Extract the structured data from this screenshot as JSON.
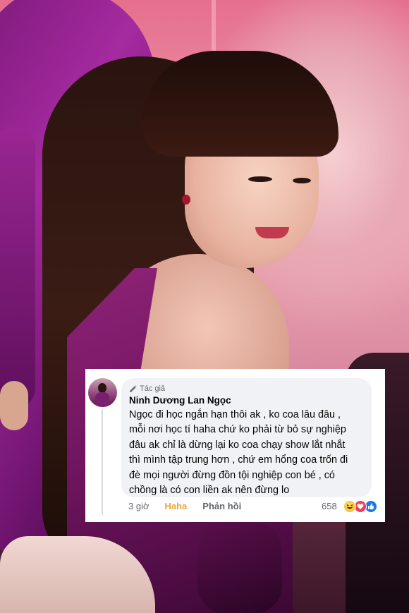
{
  "comment": {
    "author_badge": "Tác giả",
    "author_name": "Ninh Dương Lan Ngọc",
    "lines": [
      "Ngọc đi học ngắn hạn thôi ak , ko coa lâu đâu ,",
      "mỗi nơi học tí haha chứ ko phải từ bỏ sự nghiệp",
      "đâu ak chỉ là dừng lại ko coa chạy show lắt nhắt",
      "thì mình tập trung hơn , chứ em hổng coa trốn đi",
      "đè mọi người đừng đồn tội nghiệp con bé , có",
      "chồng là có con liền ak nên đừng lo"
    ],
    "time": "3 giờ",
    "reaction_selected": "Haha",
    "reply_label": "Phản hồi",
    "reaction_count": "658",
    "reaction_icons": [
      "haha-icon",
      "love-icon",
      "like-icon"
    ]
  },
  "colors": {
    "bubble": "#f0f2f5",
    "haha_text": "#e9a83a",
    "meta_text": "#65676b",
    "like_blue": "#1877f2",
    "love_red": "#f33e58"
  }
}
